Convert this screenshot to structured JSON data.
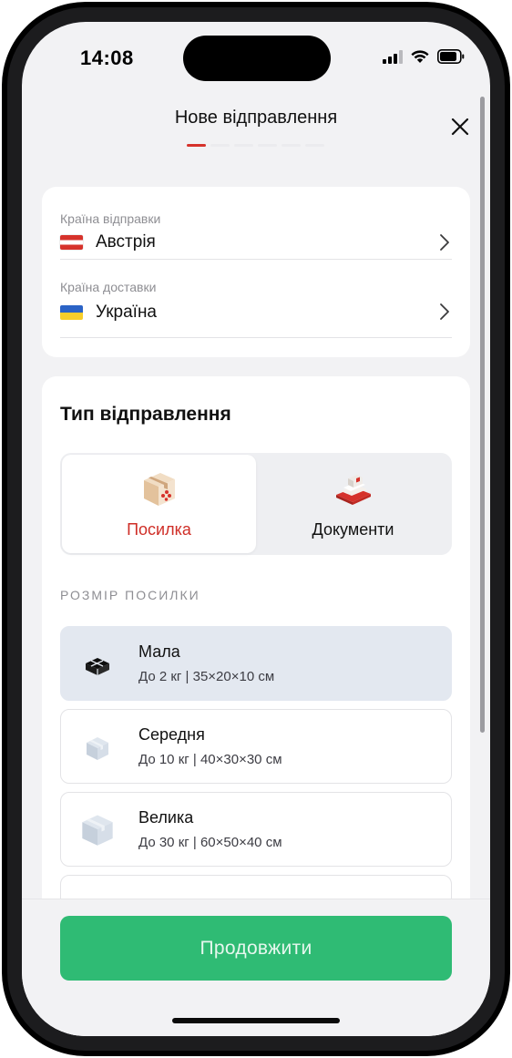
{
  "status": {
    "time": "14:08"
  },
  "header": {
    "title": "Нове відправлення",
    "steps_total": 6,
    "step_current": 1
  },
  "countries": {
    "from_label": "Країна відправки",
    "from_value": "Австрія",
    "to_label": "Країна доставки",
    "to_value": "Україна"
  },
  "shipment_type": {
    "title": "Тип відправлення",
    "options": [
      {
        "label": "Посилка",
        "icon": "parcel-icon",
        "selected": true
      },
      {
        "label": "Документи",
        "icon": "documents-icon",
        "selected": false
      }
    ]
  },
  "size": {
    "heading": "РОЗМІР ПОСИЛКИ",
    "items": [
      {
        "name": "Мала",
        "desc": "До 2 кг | 35×20×10 см",
        "icon": "small-box-icon",
        "selected": true
      },
      {
        "name": "Середня",
        "desc": "До 10 кг | 40×30×30 см",
        "icon": "medium-box-icon",
        "selected": false
      },
      {
        "name": "Велика",
        "desc": "До 30 кг | 60×50×40 см",
        "icon": "large-box-icon",
        "selected": false
      }
    ]
  },
  "footer": {
    "continue_label": "Продовжити"
  },
  "colors": {
    "accent": "#d6322b",
    "primary_button": "#2fbb74",
    "selected_item": "#e3e8f0"
  }
}
